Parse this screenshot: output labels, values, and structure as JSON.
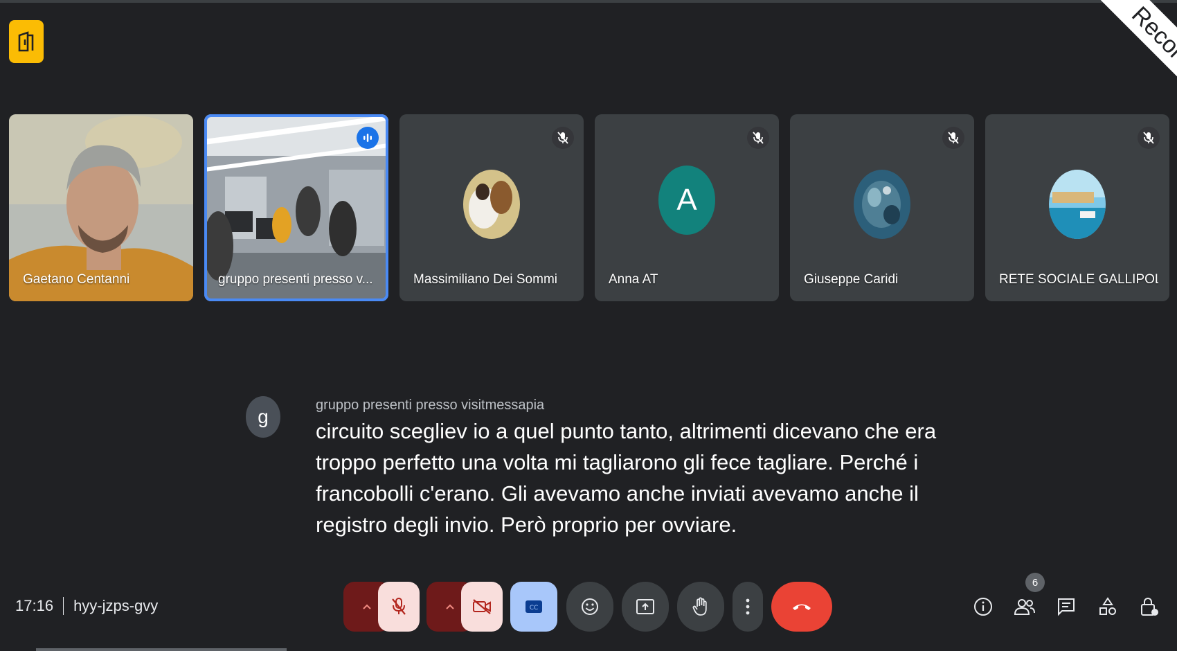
{
  "recording": {
    "label": "Recorder"
  },
  "participants": [
    {
      "name": "Gaetano Centanni",
      "type": "video"
    },
    {
      "name": "gruppo presenti presso v...",
      "type": "video",
      "speaking": true
    },
    {
      "name": "Massimiliano Dei Sommi",
      "type": "avatar",
      "muted": true
    },
    {
      "name": "Anna AT",
      "type": "letter",
      "letter": "A",
      "muted": true
    },
    {
      "name": "Giuseppe Caridi",
      "type": "avatar",
      "muted": true
    },
    {
      "name": "RETE SOCIALE GALLIPOLI",
      "type": "avatar",
      "muted": true
    }
  ],
  "caption": {
    "avatar_letter": "g",
    "speaker": "gruppo presenti presso visitmessapia",
    "text": "circuito scegliev io a quel punto tanto, altrimenti dicevano che era troppo perfetto una volta mi tagliarono gli fece tagliare. Perché i francobolli c'erano. Gli avevamo anche inviati avevamo anche il registro degli invio. Però proprio per ovviare."
  },
  "meeting": {
    "time": "17:16",
    "code": "hyy-jzps-gvy"
  },
  "people_count": "6",
  "colors": {
    "background": "#202124",
    "tile": "#3c4043",
    "active_outline": "#4a8af4",
    "end_call": "#ea4335",
    "muted_control": "#f9dedc",
    "captions_on": "#a8c7fa",
    "logo": "#fbbc04"
  },
  "icons": {
    "controls": [
      "chevron-up-icon",
      "mic-off-icon",
      "chevron-up-icon",
      "videocam-off-icon",
      "closed-caption-icon",
      "emoji-icon",
      "present-icon",
      "raise-hand-icon",
      "more-vert-icon",
      "call-end-icon"
    ],
    "right": [
      "info-icon",
      "people-icon",
      "chat-icon",
      "activities-icon",
      "host-controls-icon"
    ]
  }
}
